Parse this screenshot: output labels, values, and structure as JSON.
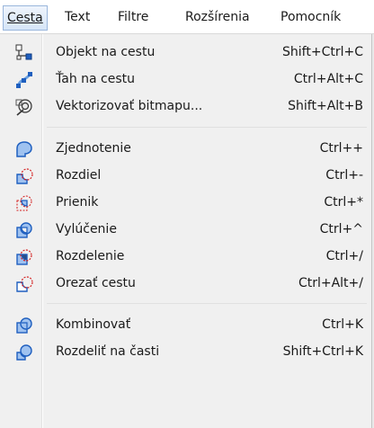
{
  "menubar": {
    "items": [
      {
        "text": "Cesta",
        "mnemonic": "C"
      },
      {
        "text": "Text",
        "mnemonic": "T"
      },
      {
        "text": "Filtre",
        "mnemonic": "F"
      },
      {
        "text": "Rozšírenia",
        "mnemonic": "n"
      },
      {
        "text": "Pomocník",
        "mnemonic": "P"
      }
    ]
  },
  "menu": {
    "items": [
      {
        "label": "Objekt na cestu",
        "shortcut": "Shift+Ctrl+C",
        "icon": "object-to-path-icon"
      },
      {
        "label": "Ťah na cestu",
        "shortcut": "Ctrl+Alt+C",
        "icon": "stroke-to-path-icon"
      },
      {
        "label": "Vektorizovať bitmapu...",
        "shortcut": "Shift+Alt+B",
        "icon": "trace-bitmap-icon"
      },
      {
        "label": "Zjednotenie",
        "shortcut": "Ctrl++",
        "icon": "union-icon"
      },
      {
        "label": "Rozdiel",
        "shortcut": "Ctrl+-",
        "icon": "difference-icon"
      },
      {
        "label": "Prienik",
        "shortcut": "Ctrl+*",
        "icon": "intersection-icon"
      },
      {
        "label": "Vylúčenie",
        "shortcut": "Ctrl+^",
        "icon": "exclusion-icon"
      },
      {
        "label": "Rozdelenie",
        "shortcut": "Ctrl+/",
        "icon": "division-icon"
      },
      {
        "label": "Orezať cestu",
        "shortcut": "Ctrl+Alt+/",
        "icon": "cut-path-icon"
      },
      {
        "label": "Kombinovať",
        "shortcut": "Ctrl+K",
        "icon": "combine-icon"
      },
      {
        "label": "Rozdeliť na časti",
        "shortcut": "Shift+Ctrl+K",
        "icon": "break-apart-icon"
      }
    ]
  },
  "colors": {
    "accent_blue": "#1f5fbf",
    "light_blue": "#9fc2f0",
    "red": "#d42020",
    "menu_bg": "#f0f0f0"
  }
}
